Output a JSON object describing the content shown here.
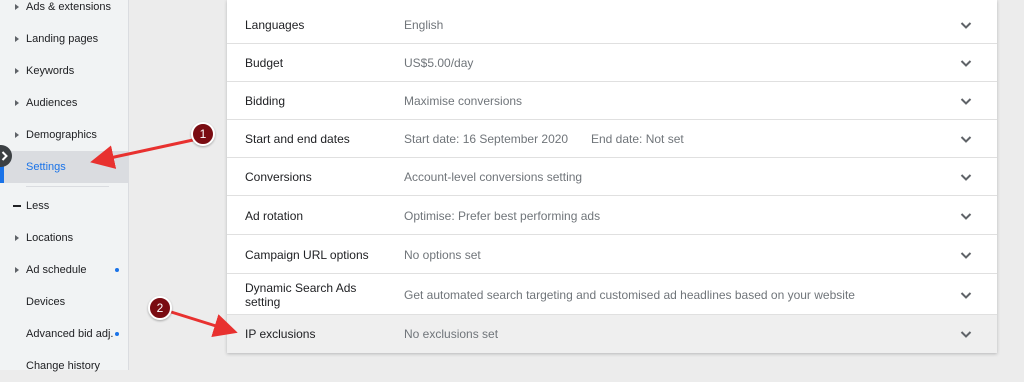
{
  "sidebar": {
    "items": [
      {
        "label": "Ads & extensions",
        "caret": true
      },
      {
        "label": "Landing pages",
        "caret": true
      },
      {
        "label": "Keywords",
        "caret": true
      },
      {
        "label": "Audiences",
        "caret": true
      },
      {
        "label": "Demographics",
        "caret": true
      },
      {
        "label": "Settings",
        "active": true
      },
      {
        "label": "Less"
      },
      {
        "label": "Locations",
        "caret": true
      },
      {
        "label": "Ad schedule",
        "caret": true,
        "dot": true
      },
      {
        "label": "Devices"
      },
      {
        "label": "Advanced bid adj.",
        "dot": true
      },
      {
        "label": "Change history"
      }
    ]
  },
  "settings": {
    "rows": [
      {
        "name": "Languages",
        "value": "English"
      },
      {
        "name": "Budget",
        "value": "US$5.00/day"
      },
      {
        "name": "Bidding",
        "value": "Maximise conversions"
      },
      {
        "name": "Start and end dates",
        "value": "Start date: 16 September 2020",
        "value2": "End date: Not set"
      },
      {
        "name": "Conversions",
        "value": "Account-level conversions setting"
      },
      {
        "name": "Ad rotation",
        "value": "Optimise: Prefer best performing ads"
      },
      {
        "name": "Campaign URL options",
        "value": "No options set"
      },
      {
        "name": "Dynamic Search Ads setting",
        "value": "Get automated search targeting and customised ad headlines based on your website"
      },
      {
        "name": "IP exclusions",
        "value": "No exclusions set",
        "highlighted": true
      }
    ]
  },
  "annotations": {
    "badge1": "1",
    "badge2": "2",
    "color": "#7a0c12",
    "arrow_color": "#e8312f"
  },
  "colors": {
    "accent": "#1a73e8",
    "sidebar_bg": "#f1f3f4",
    "page_bg": "#ececec"
  }
}
